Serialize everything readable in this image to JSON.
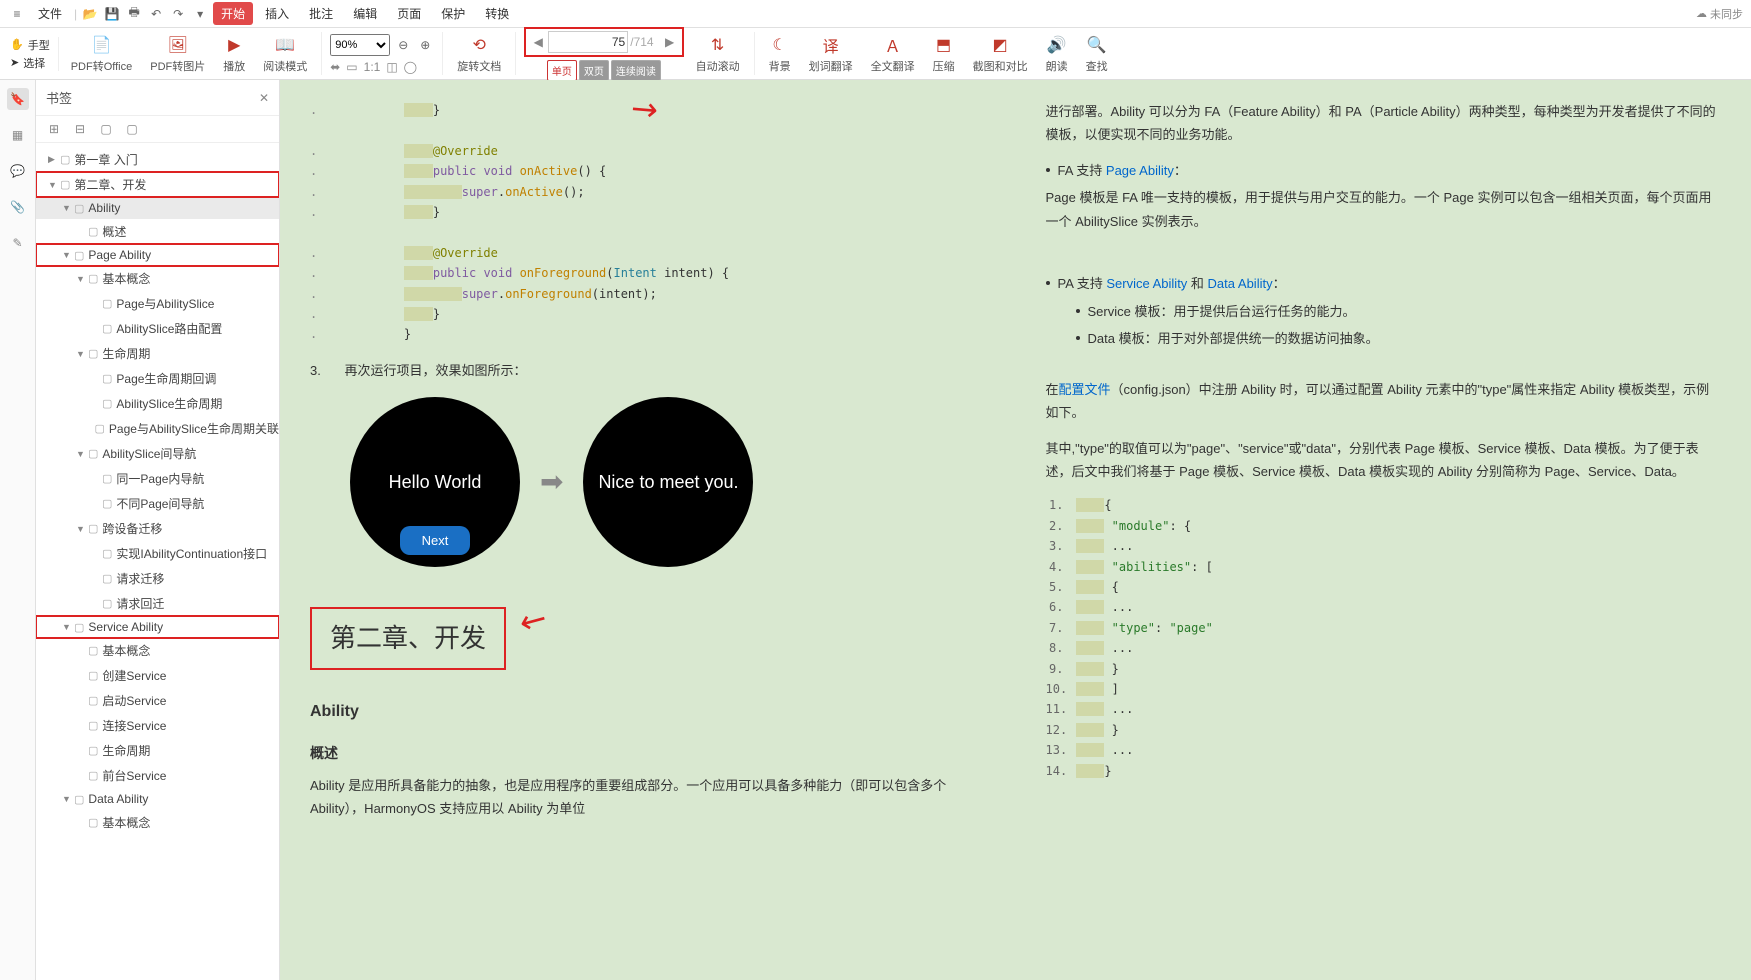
{
  "menubar": {
    "file": "文件",
    "tabs": [
      "开始",
      "插入",
      "批注",
      "编辑",
      "页面",
      "保护",
      "转换"
    ],
    "active_tab": 0,
    "sync": "未同步"
  },
  "toolbar": {
    "hand": "手型",
    "select": "选择",
    "pdf_to_office": "PDF转Office",
    "pdf_to_image": "PDF转图片",
    "play": "播放",
    "read_mode": "阅读模式",
    "zoom_value": "90%",
    "rotate_doc": "旋转文档",
    "page_current": "75",
    "page_total": "/714",
    "single_page": "单页",
    "double_page": "双页",
    "continuous": "连续阅读",
    "auto_scroll": "自动滚动",
    "background": "背景",
    "word_translate": "划词翻译",
    "full_translate": "全文翻译",
    "compress": "压缩",
    "screenshot_compare": "截图和对比",
    "read_aloud": "朗读",
    "find": "查找"
  },
  "bookmarks": {
    "title": "书签",
    "items": [
      {
        "depth": 1,
        "label": "第一章 入门",
        "caret": "▶"
      },
      {
        "depth": 1,
        "label": "第二章、开发",
        "caret": "▼",
        "red": true
      },
      {
        "depth": 2,
        "label": "Ability",
        "caret": "▼",
        "selected": true
      },
      {
        "depth": 3,
        "label": "概述",
        "caret": ""
      },
      {
        "depth": 2,
        "label": "Page Ability",
        "caret": "▼",
        "red": true
      },
      {
        "depth": 3,
        "label": "基本概念",
        "caret": "▼"
      },
      {
        "depth": 4,
        "label": "Page与AbilitySlice",
        "caret": ""
      },
      {
        "depth": 4,
        "label": "AbilitySlice路由配置",
        "caret": ""
      },
      {
        "depth": 3,
        "label": "生命周期",
        "caret": "▼"
      },
      {
        "depth": 4,
        "label": "Page生命周期回调",
        "caret": ""
      },
      {
        "depth": 4,
        "label": "AbilitySlice生命周期",
        "caret": ""
      },
      {
        "depth": 4,
        "label": "Page与AbilitySlice生命周期关联",
        "caret": ""
      },
      {
        "depth": 3,
        "label": "AbilitySlice间导航",
        "caret": "▼"
      },
      {
        "depth": 4,
        "label": "同一Page内导航",
        "caret": ""
      },
      {
        "depth": 4,
        "label": "不同Page间导航",
        "caret": ""
      },
      {
        "depth": 3,
        "label": "跨设备迁移",
        "caret": "▼"
      },
      {
        "depth": 4,
        "label": "实现IAbilityContinuation接口",
        "caret": ""
      },
      {
        "depth": 4,
        "label": "请求迁移",
        "caret": ""
      },
      {
        "depth": 4,
        "label": "请求回迁",
        "caret": ""
      },
      {
        "depth": 2,
        "label": "Service Ability",
        "caret": "▼",
        "red": true
      },
      {
        "depth": 3,
        "label": "基本概念",
        "caret": ""
      },
      {
        "depth": 3,
        "label": "创建Service",
        "caret": ""
      },
      {
        "depth": 3,
        "label": "启动Service",
        "caret": ""
      },
      {
        "depth": 3,
        "label": "连接Service",
        "caret": ""
      },
      {
        "depth": 3,
        "label": "生命周期",
        "caret": ""
      },
      {
        "depth": 3,
        "label": "前台Service",
        "caret": ""
      },
      {
        "depth": 2,
        "label": "Data Ability",
        "caret": "▼"
      },
      {
        "depth": 3,
        "label": "基本概念",
        "caret": ""
      }
    ]
  },
  "doc": {
    "step3": "再次运行项目，效果如图所示：",
    "circle1": "Hello World",
    "circle1_btn": "Next",
    "circle2": "Nice to meet you.",
    "chapter_title": "第二章、开发",
    "ability_h": "Ability",
    "overview_h": "概述",
    "overview_p": "Ability 是应用所具备能力的抽象，也是应用程序的重要组成部分。一个应用可以具备多种能力（即可以包含多个 Ability），HarmonyOS 支持应用以 Ability 为单位",
    "right_p1_a": "进行部署。Ability 可以分为 FA（Feature Ability）和 PA（Particle Ability）两种类型，每种类型为开发者提供了不同的模板，以便实现不同的业务功能。",
    "fa_support": "FA 支持 ",
    "fa_link": "Page Ability",
    "fa_p": "Page 模板是 FA 唯一支持的模板，用于提供与用户交互的能力。一个 Page 实例可以包含一组相关页面，每个页面用一个 AbilitySlice 实例表示。",
    "pa_support": "PA 支持 ",
    "pa_link1": "Service Ability",
    "pa_and": " 和 ",
    "pa_link2": "Data Ability",
    "svc_tpl": "Service 模板：用于提供后台运行任务的能力。",
    "data_tpl": "Data 模板：用于对外部提供统一的数据访问抽象。",
    "config_p_a": "在",
    "config_link": "配置文件",
    "config_p_b": "（config.json）中注册 Ability 时，可以通过配置 Ability 元素中的\"type\"属性来指定 Ability 模板类型，示例如下。",
    "type_p": "其中,\"type\"的取值可以为\"page\"、\"service\"或\"data\"，分别代表 Page 模板、Service 模板、Data 模板。为了便于表述，后文中我们将基于 Page 模板、Service 模板、Data 模板实现的 Ability 分别简称为 Page、Service、Data。",
    "json_lines": [
      "{",
      "    \"module\": {",
      "        ...",
      "        \"abilities\": [",
      "            {",
      "                ...",
      "                \"type\": \"page\"",
      "                ...",
      "            }",
      "        ]",
      "        ...",
      "    }",
      "    ...",
      "}"
    ]
  }
}
